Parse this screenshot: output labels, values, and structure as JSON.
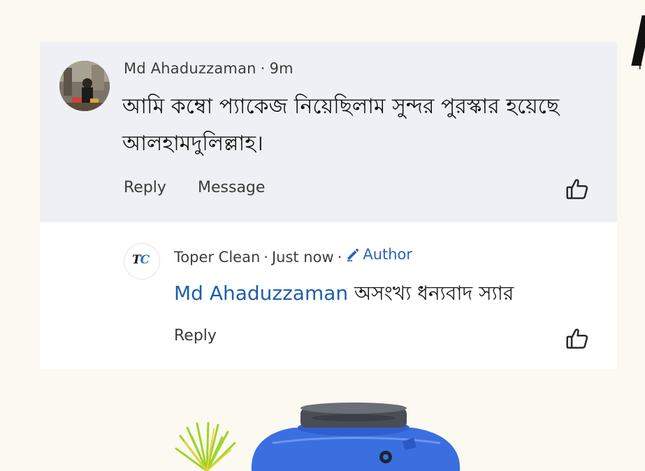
{
  "comment": {
    "author": "Md Ahaduzzaman",
    "time": "9m",
    "separator": "·",
    "text": "আমি কম্বো প্যাকেজ নিয়েছিলাম সুন্দর পুরস্কার হয়েছে আলহামদুলিল্লাহ।",
    "actions": {
      "reply": "Reply",
      "message": "Message"
    },
    "avatar_icon": "user-photo"
  },
  "reply": {
    "author": "Toper Clean",
    "time": "Just now",
    "separator": "·",
    "badge": "Author",
    "avatar_text_dark": "T",
    "avatar_text_blue": "C",
    "mention": "Md Ahaduzzaman",
    "text": " অসংখ্য ধন্যবাদ স্যার",
    "actions": {
      "reply": "Reply"
    }
  },
  "icons": {
    "like": "thumbs-up-icon",
    "author_badge": "pencil-icon"
  },
  "colors": {
    "comment_bg": "#eff0f5",
    "reply_bg": "#ffffff",
    "page_bg": "#fcf9f1",
    "link_blue": "#1f5fa9",
    "tank_blue": "#3b6fe0"
  }
}
